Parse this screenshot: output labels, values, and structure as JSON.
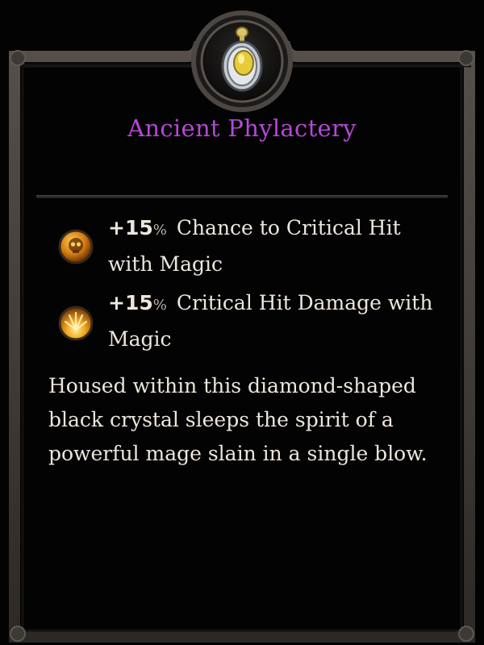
{
  "item": {
    "name": "Ancient Phylactery",
    "icon": "amulet-icon",
    "name_color": "#b548d6"
  },
  "stats": [
    {
      "value": "+15",
      "unit": "%",
      "text": "Chance to Critical Hit with Magic",
      "icon": "skull-orb-icon"
    },
    {
      "value": "+15",
      "unit": "%",
      "text": "Critical Hit Damage with Magic",
      "icon": "burst-orb-icon"
    }
  ],
  "description": "Housed within this diamond-shaped black crystal sleeps the spirit of a powerful mage slain in a single blow."
}
